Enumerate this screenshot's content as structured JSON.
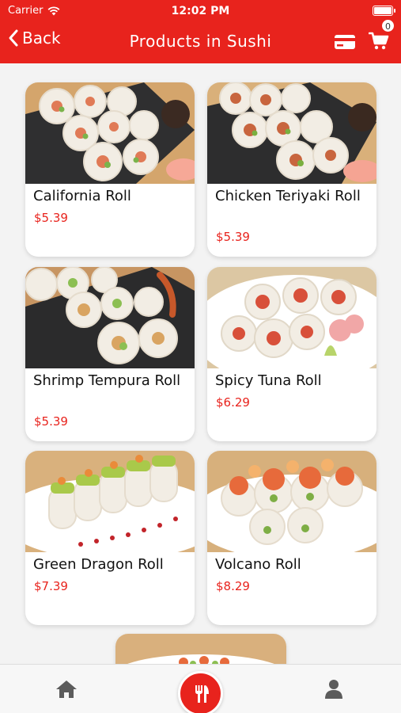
{
  "status_bar": {
    "carrier": "Carrier",
    "time": "12:02 PM"
  },
  "navbar": {
    "back_label": "Back",
    "title": "Products in Sushi",
    "cart_count": "0"
  },
  "products": [
    {
      "name": "California Roll",
      "price": "$5.39"
    },
    {
      "name": "Chicken Teriyaki Roll",
      "price": "$5.39"
    },
    {
      "name": "Shrimp Tempura Roll",
      "price": "$5.39"
    },
    {
      "name": "Spicy Tuna Roll",
      "price": "$6.29"
    },
    {
      "name": "Green Dragon Roll",
      "price": "$7.39"
    },
    {
      "name": "Volcano Roll",
      "price": "$8.29"
    }
  ],
  "tabbar": {
    "items": [
      "home-icon",
      "utensils-icon",
      "user-icon"
    ]
  },
  "colors": {
    "accent": "#e8231d",
    "background": "#f3f3f3"
  }
}
